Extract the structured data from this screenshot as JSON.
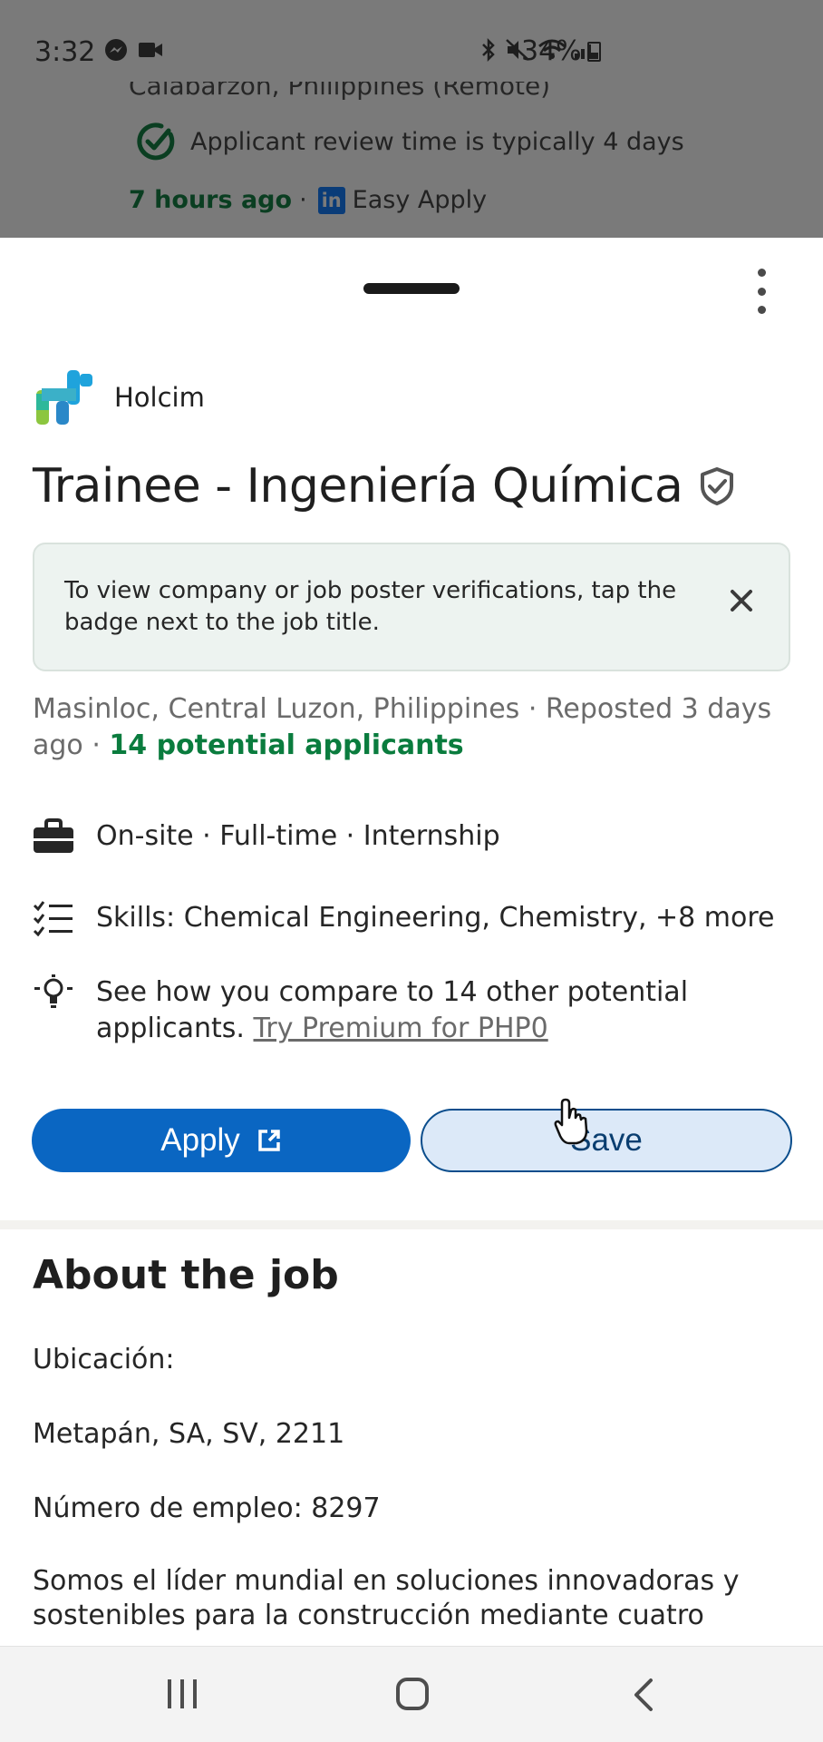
{
  "status_bar": {
    "time": "3:32",
    "battery": "34%"
  },
  "background_listing": {
    "location": "Calabarzon, Philippines (Remote)",
    "review_time": "Applicant review time is typically 4 days",
    "posted": "7 hours ago",
    "separator": "·",
    "linkedin_icon": "in",
    "easy_apply": "Easy Apply"
  },
  "job": {
    "company": "Holcim",
    "title": "Trainee - Ingeniería Química",
    "notice": "To view company or job poster verifications, tap the badge next to the job title.",
    "location_line": "Masinloc, Central Luzon, Philippines · Reposted 3 days ago · ",
    "applicants": "14 potential applicants",
    "job_type": "On-site · Full-time · Internship",
    "skills": "Skills: Chemical Engineering, Chemistry, +8 more",
    "compare": "See how you compare to 14 other potential applicants. ",
    "premium_link": "Try Premium for PHP0",
    "apply_label": "Apply",
    "save_label": "Save"
  },
  "about": {
    "title": "About the job",
    "ubicacion_label": "Ubicación:",
    "ubicacion_value": "Metapán, SA, SV, 2211",
    "numero": "Número de empleo: 8297",
    "description": "Somos el líder mundial en soluciones innovadoras y sostenibles para la construcción mediante cuatro"
  },
  "icons": {
    "review": "check-circle-icon",
    "verify": "shield-check-icon",
    "close": "close-icon",
    "briefcase": "briefcase-icon",
    "skills": "checklist-icon",
    "compare": "lightbulb-icon",
    "external": "external-link-icon",
    "more": "more-vertical-icon"
  },
  "colors": {
    "primary": "#0a66c2",
    "success": "#0a7c3e",
    "notice_bg": "#edf3f0"
  }
}
